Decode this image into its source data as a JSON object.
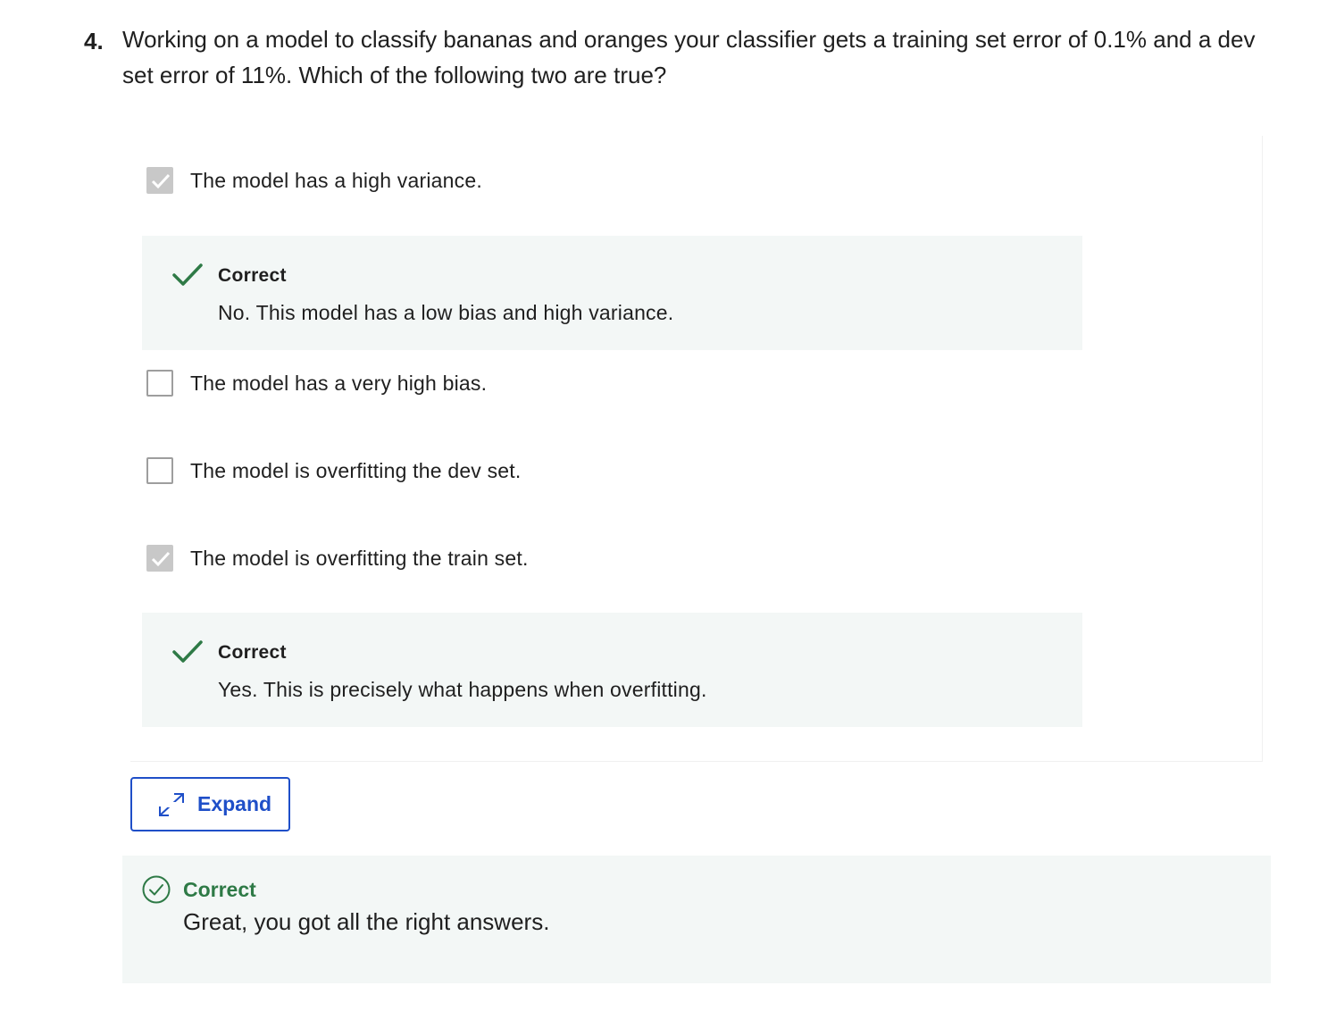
{
  "question": {
    "number": "4.",
    "text": "Working on a model to classify bananas and oranges your classifier gets a training set error of 0.1% and a dev set error of 11%. Which of the following two are true?"
  },
  "options": [
    {
      "label": "The model has a high variance.",
      "checked": true,
      "feedback": {
        "title": "Correct",
        "text": "No. This model has a low bias and high variance."
      }
    },
    {
      "label": "The model has a very high bias.",
      "checked": false
    },
    {
      "label": "The model is overfitting the dev set.",
      "checked": false
    },
    {
      "label": "The model is overfitting the train set.",
      "checked": true,
      "feedback": {
        "title": "Correct",
        "text": "Yes. This is precisely what happens when overfitting."
      }
    }
  ],
  "expand_button": {
    "label": "Expand",
    "icon": "expand-arrows-icon"
  },
  "result": {
    "title": "Correct",
    "text": "Great, you got all the right answers.",
    "icon": "check-circle-icon"
  },
  "colors": {
    "accent_blue": "#1f4fc8",
    "success_green": "#2e7a46",
    "feedback_bg": "#f3f7f6",
    "checkbox_checked": "#c8c8c8"
  }
}
